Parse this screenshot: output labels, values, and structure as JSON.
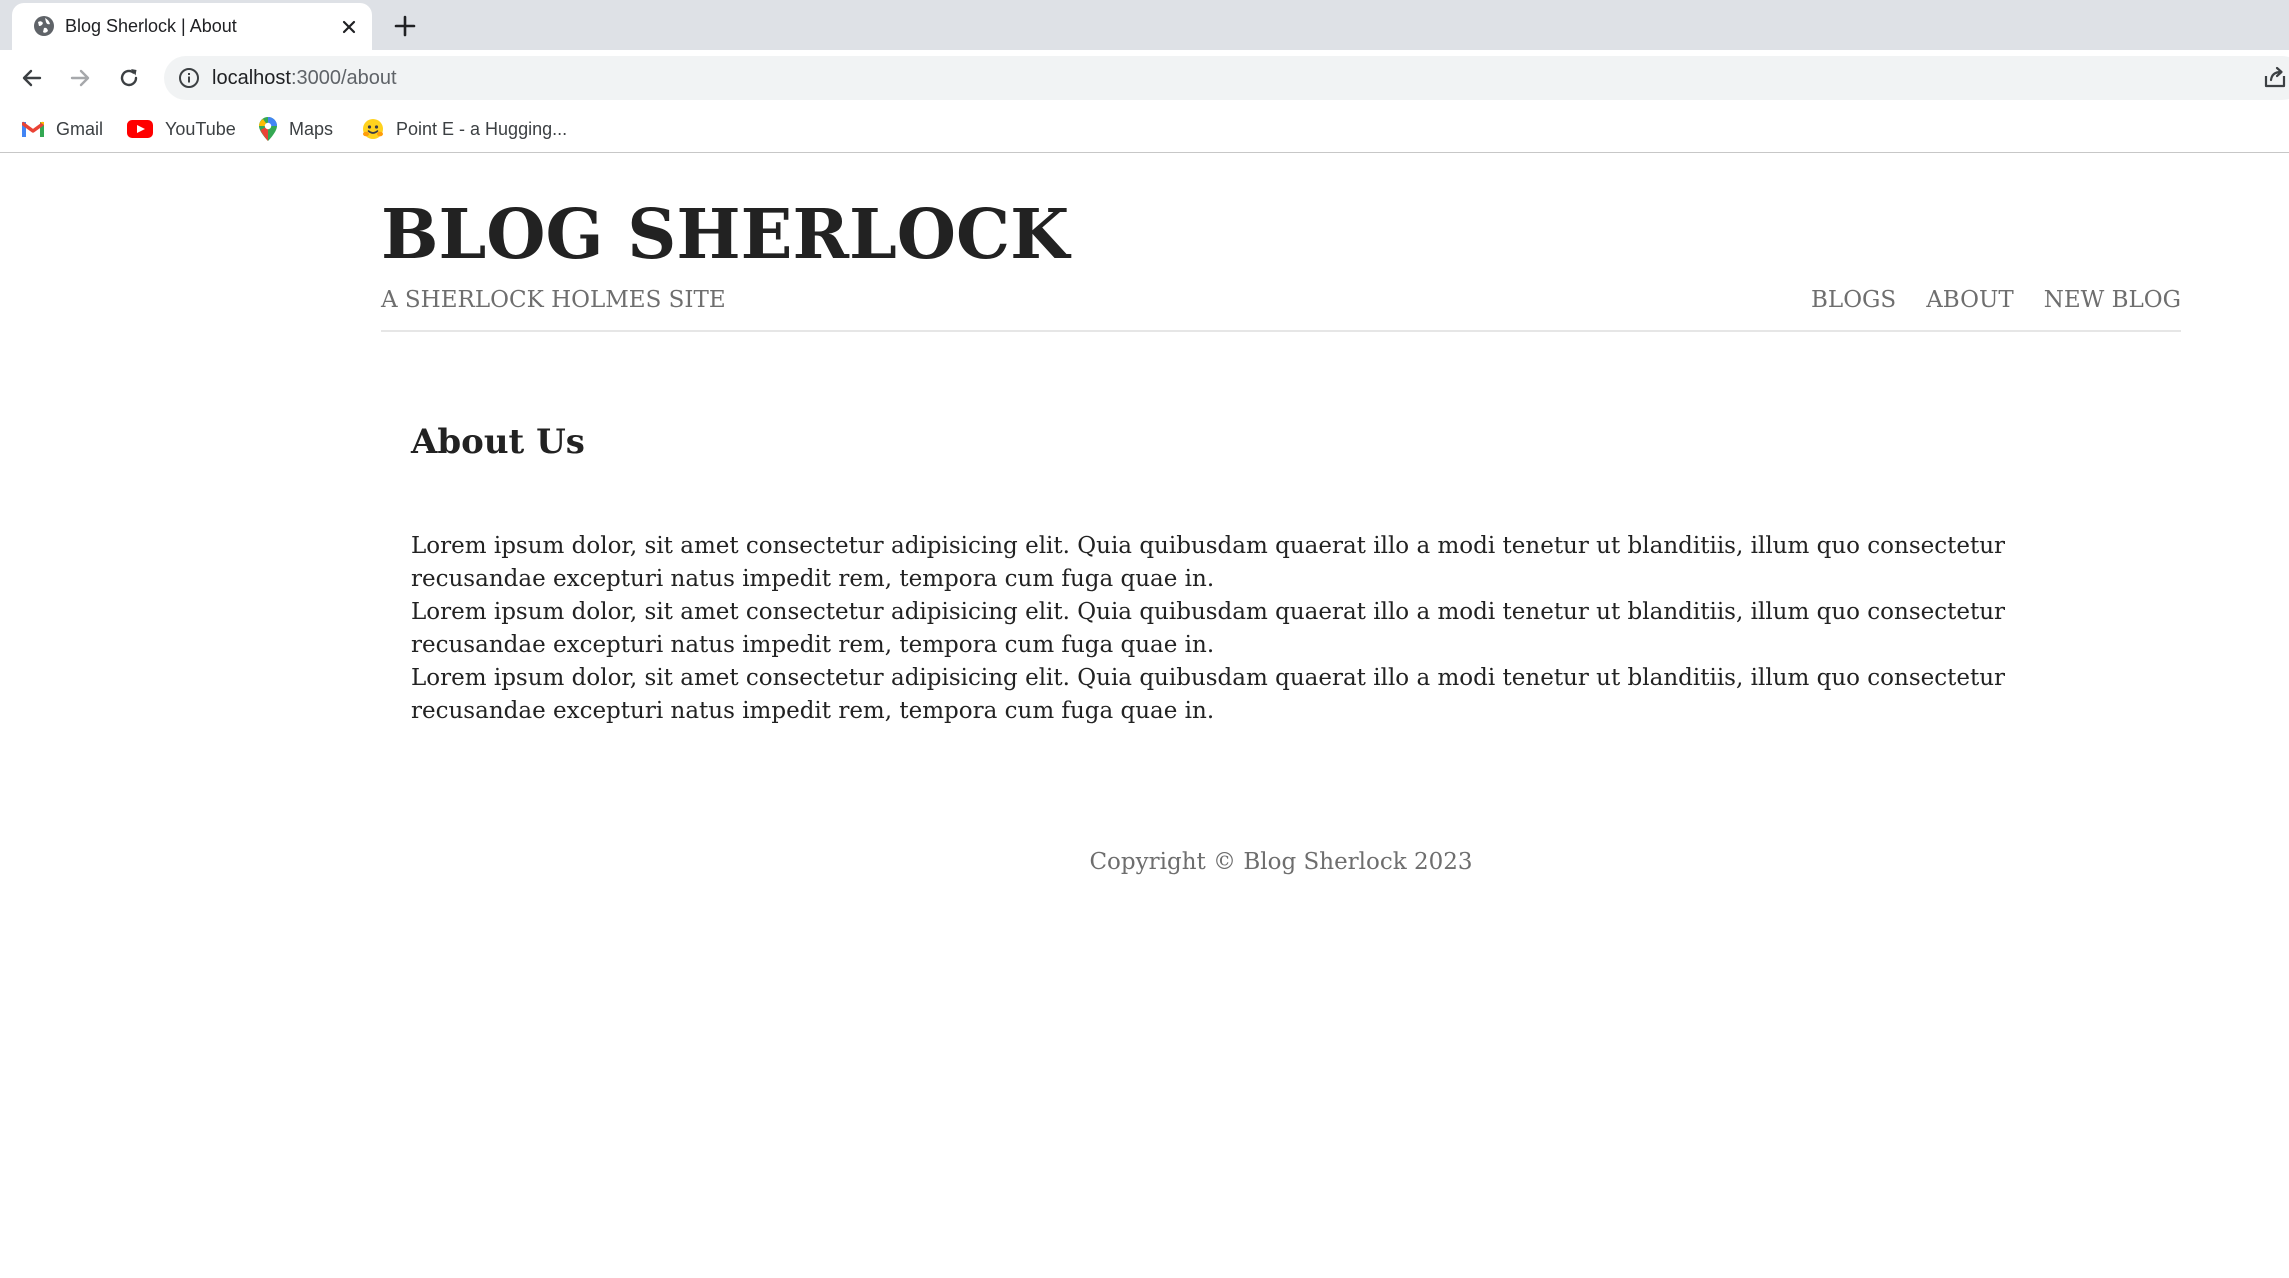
{
  "browser": {
    "tab": {
      "title": "Blog Sherlock | About"
    },
    "address_bar": {
      "host": "localhost",
      "path": ":3000/about"
    },
    "bookmarks": [
      {
        "label": "Gmail",
        "icon": "gmail-icon"
      },
      {
        "label": "YouTube",
        "icon": "youtube-icon"
      },
      {
        "label": "Maps",
        "icon": "maps-icon"
      },
      {
        "label": "Point E - a Hugging...",
        "icon": "hugging-face-icon"
      }
    ]
  },
  "site": {
    "title": "BLOG SHERLOCK",
    "subtitle": "A SHERLOCK HOLMES SITE",
    "nav": [
      {
        "label": "BLOGS"
      },
      {
        "label": "ABOUT"
      },
      {
        "label": "NEW BLOG"
      }
    ]
  },
  "about": {
    "heading": "About Us",
    "paragraphs": [
      "Lorem ipsum dolor, sit amet consectetur adipisicing elit. Quia quibusdam quaerat illo a modi tenetur ut blanditiis, illum quo consectetur recusandae excepturi natus impedit rem, tempora cum fuga quae in.",
      "Lorem ipsum dolor, sit amet consectetur adipisicing elit. Quia quibusdam quaerat illo a modi tenetur ut blanditiis, illum quo consectetur recusandae excepturi natus impedit rem, tempora cum fuga quae in.",
      "Lorem ipsum dolor, sit amet consectetur adipisicing elit. Quia quibusdam quaerat illo a modi tenetur ut blanditiis, illum quo consectetur recusandae excepturi natus impedit rem, tempora cum fuga quae in."
    ]
  },
  "footer": {
    "text": "Copyright © Blog Sherlock 2023"
  },
  "colors": {
    "tabstrip": "#dee1e6",
    "omnibox": "#f1f3f4",
    "title_text": "#222222",
    "muted_text": "#6e6e6e"
  }
}
